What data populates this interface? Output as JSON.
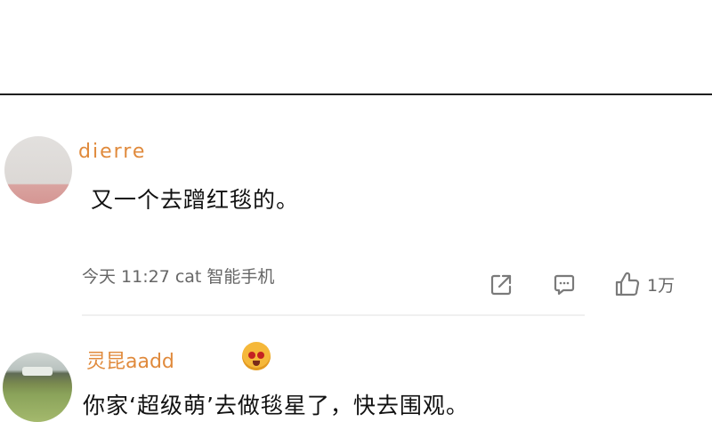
{
  "comments": [
    {
      "username": "dierre",
      "text": "又一个去蹭红毯的。",
      "meta": "今天 11:27 cat 智能手机",
      "like_count": "1万"
    },
    {
      "username": "灵昆aadd",
      "text": "你家‘超级萌’去做毯星了，快去围观。"
    }
  ],
  "icons": {
    "share": "share-icon",
    "reply": "comment-icon",
    "like": "thumbs-up-icon",
    "badge": "emoji-badge-icon"
  },
  "colors": {
    "username": "#e08a3c",
    "meta_text": "#666666",
    "divider": "#1f1f1f"
  }
}
